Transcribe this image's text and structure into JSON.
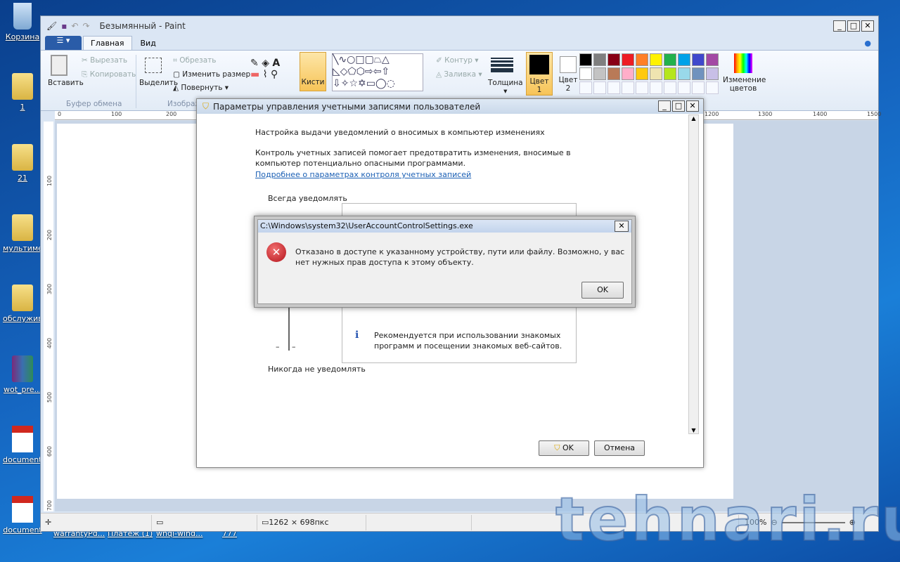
{
  "desktop": {
    "icons": [
      "Корзина",
      "1",
      "21",
      "мультимед...",
      "обслужив...",
      "wot_pre...",
      "document...",
      "document"
    ],
    "bottom_labels": [
      "warrantyPd...",
      "Платеж (1)",
      "whql-wind...",
      "777"
    ]
  },
  "paint": {
    "title": "Безымянный - Paint",
    "file_menu": "☰ ▾",
    "tabs": [
      "Главная",
      "Вид"
    ],
    "clipboard": {
      "paste": "Вставить",
      "cut": "Вырезать",
      "copy": "Копировать",
      "group": "Буфер обмена"
    },
    "image": {
      "select": "Выделить",
      "crop": "Обрезать",
      "resize": "Изменить размер",
      "rotate": "Повернуть",
      "group": "Изображение"
    },
    "brushes": "Кисти",
    "outline": "Контур",
    "fill": "Заливка",
    "size": "Толщина",
    "color1": "Цвет 1",
    "color2": "Цвет 2",
    "edit_colors": "Изменение цветов",
    "palette": [
      "#000000",
      "#7f7f7f",
      "#880015",
      "#ed1c24",
      "#ff7f27",
      "#fff200",
      "#22b14c",
      "#00a2e8",
      "#3f48cc",
      "#a349a4",
      "#ffffff",
      "#c3c3c3",
      "#b97a57",
      "#ffaec9",
      "#ffc90e",
      "#efe4b0",
      "#b5e61d",
      "#99d9ea",
      "#7092be",
      "#c8bfe7"
    ],
    "ruler_h": [
      "0",
      "100",
      "200",
      "1200",
      "1300",
      "1400",
      "1500"
    ],
    "ruler_v": [
      "100",
      "200",
      "300",
      "400",
      "500",
      "600",
      "700"
    ],
    "status": {
      "size": "1262 × 698пкс",
      "zoom": "100%"
    }
  },
  "uac": {
    "title": "Параметры управления учетными записями пользователей",
    "heading": "Настройка выдачи уведомлений о вносимых в компьютер изменениях",
    "desc": "Контроль учетных записей помогает предотвратить изменения, вносимые в компьютер потенциально опасными программами.",
    "link": "Подробнее о параметрах контроля учетных записей",
    "always": "Всегда уведомлять",
    "never": "Никогда не уведомлять",
    "info": "Рекомендуется при использовании знакомых программ и посещении знакомых веб-сайтов.",
    "ok": "OK",
    "cancel": "Отмена"
  },
  "error": {
    "title": "C:\\Windows\\system32\\UserAccountControlSettings.exe",
    "message": "Отказано в доступе к указанному устройству, пути или файлу. Возможно,  у вас нет нужных прав доступа к этому объекту.",
    "ok": "OK"
  },
  "watermark": "tehnari.ru"
}
